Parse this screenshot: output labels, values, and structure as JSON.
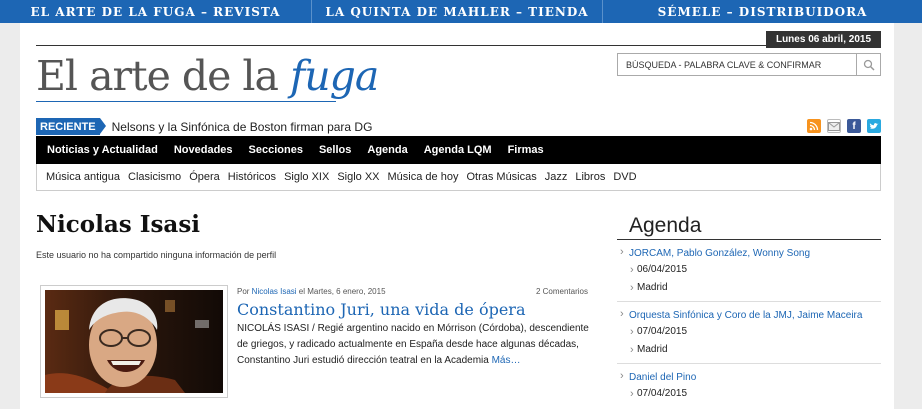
{
  "top_links": [
    "EL ARTE DE LA FUGA – REVISTA",
    "LA QUINTA DE MAHLER – TIENDA",
    "SÉMELE – DISTRIBUIDORA"
  ],
  "date": "Lunes 06 abril, 2015",
  "logo": {
    "part1": "El arte de la ",
    "part2": "fuga"
  },
  "search": {
    "placeholder": "BÚSQUEDA - PALABRA CLAVE & CONFIRMAR"
  },
  "reciente": {
    "label": "RECIENTE",
    "text": "Nelsons y la Sinfónica de Boston firman para DG"
  },
  "social_icons": [
    "rss-icon",
    "email-icon",
    "facebook-icon",
    "twitter-icon"
  ],
  "colors": {
    "brand": "#1d66b4",
    "rss": "#f7931e",
    "facebook": "#3b5998",
    "twitter": "#2aa9e0"
  },
  "main_nav": [
    "Noticias y Actualidad",
    "Novedades",
    "Secciones",
    "Sellos",
    "Agenda",
    "Agenda LQM",
    "Firmas"
  ],
  "sub_nav": [
    "Música antigua",
    "Clasicismo",
    "Ópera",
    "Históricos",
    "Siglo XIX",
    "Siglo XX",
    "Música de hoy",
    "Otras Músicas",
    "Jazz",
    "Libros",
    "DVD"
  ],
  "user": {
    "name": "Nicolas Isasi",
    "description": "Este usuario no ha compartido ninguna información de perfil"
  },
  "post": {
    "by_prefix": "Por ",
    "author": "Nicolas Isasi",
    "date": " el Martes, 6 enero, 2015",
    "comments": "2 Comentarios",
    "title": "Constantino Juri, una vida de ópera",
    "excerpt": "NICOLÁS ISASI / Regié argentino nacido en Mórrison (Córdoba), descendiente de griegos, y radicado actualmente en España desde hace algunas décadas, Constantino Juri estudió dirección teatral en la Academia ",
    "more": "Más…"
  },
  "agenda": {
    "title": "Agenda",
    "items": [
      {
        "title": "JORCAM, Pablo González, Wonny Song",
        "date": "06/04/2015",
        "place": "Madrid"
      },
      {
        "title": "Orquesta Sinfónica y Coro de la JMJ, Jaime Maceira",
        "date": "07/04/2015",
        "place": "Madrid"
      },
      {
        "title": "Daniel del Pino",
        "date": "07/04/2015",
        "place": ""
      }
    ]
  }
}
